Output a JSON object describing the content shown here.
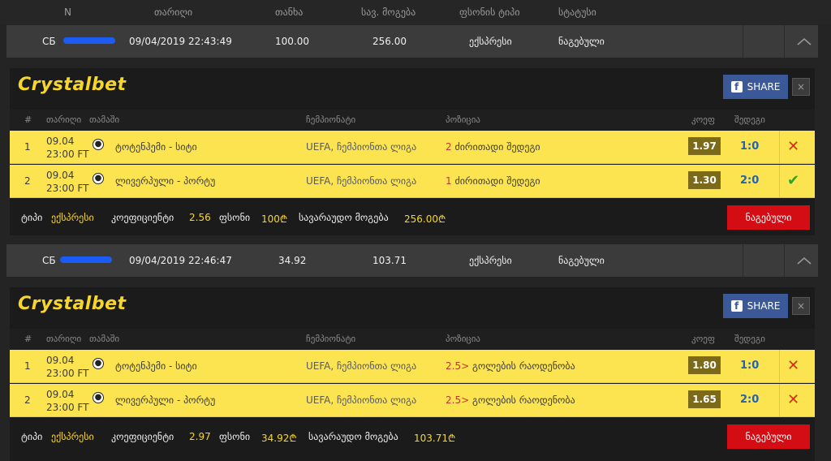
{
  "header": {
    "n": "N",
    "date": "თარიღი",
    "amount": "თანხა",
    "potential": "სავ. მოგება",
    "type": "ფსონის ტიპი",
    "status": "სტატუსი"
  },
  "slips": [
    {
      "id": "СБ",
      "date": "09/04/2019 22:43:49",
      "amount": "100.00",
      "potential": "256.00",
      "type": "ექსპრესი",
      "status": "ნაგებული",
      "card": {
        "logo": "Crystalbet",
        "share_label": "SHARE",
        "close_label": "×",
        "columns": {
          "num": "#",
          "date": "თარიღი",
          "match": "თამაში",
          "champ": "ჩემპიონატი",
          "pos": "პოზიცია",
          "odd": "კოეფ",
          "result": "შედეგი"
        },
        "bets": [
          {
            "num": "1",
            "date": "09.04",
            "time": "23:00 FT",
            "match": "ტოტენჰემი - სიტი",
            "champ": "UEFA, ჩემპიონთა ლიგა",
            "pos_hl": "2",
            "pos_rest": " ძირითადი შედეგი",
            "odd": "1.97",
            "result": "1:0",
            "mark": "✕",
            "mark_type": "loss"
          },
          {
            "num": "2",
            "date": "09.04",
            "time": "23:00 FT",
            "match": "ლივერპული - პორტუ",
            "champ": "UEFA, ჩემპიონთა ლიგა",
            "pos_hl": "1",
            "pos_rest": " ძირითადი შედეგი",
            "odd": "1.30",
            "result": "2:0",
            "mark": "✔",
            "mark_type": "win"
          }
        ],
        "summary": {
          "type_label": "ტიპი",
          "type_value": "ექსპრესი",
          "coef_label": "კოეფიციენტი",
          "coef_value": "2.56",
          "stake_label": "ფსონი",
          "stake_value": "100₾",
          "pot_label": "სავარაუდო მოგება",
          "pot_value": "256.00₾",
          "status": "ნაგებული"
        }
      }
    },
    {
      "id": "СБ",
      "date": "09/04/2019 22:46:47",
      "amount": "34.92",
      "potential": "103.71",
      "type": "ექსპრესი",
      "status": "ნაგებული",
      "card": {
        "logo": "Crystalbet",
        "share_label": "SHARE",
        "close_label": "×",
        "columns": {
          "num": "#",
          "date": "თარიღი",
          "match": "თამაში",
          "champ": "ჩემპიონატი",
          "pos": "პოზიცია",
          "odd": "კოეფ",
          "result": "შედეგი"
        },
        "bets": [
          {
            "num": "1",
            "date": "09.04",
            "time": "23:00 FT",
            "match": "ტოტენჰემი - სიტი",
            "champ": "UEFA, ჩემპიონთა ლიგა",
            "pos_hl": "2.5>",
            "pos_rest": " გოლების რაოდენობა",
            "odd": "1.80",
            "result": "1:0",
            "mark": "✕",
            "mark_type": "loss"
          },
          {
            "num": "2",
            "date": "09.04",
            "time": "23:00 FT",
            "match": "ლივერპული - პორტუ",
            "champ": "UEFA, ჩემპიონთა ლიგა",
            "pos_hl": "2.5>",
            "pos_rest": " გოლების რაოდენობა",
            "odd": "1.65",
            "result": "2:0",
            "mark": "✕",
            "mark_type": "loss"
          }
        ],
        "summary": {
          "type_label": "ტიპი",
          "type_value": "ექსპრესი",
          "coef_label": "კოეფიციენტი",
          "coef_value": "2.97",
          "stake_label": "ფსონი",
          "stake_value": "34.92₾",
          "pot_label": "სავარაუდო მოგება",
          "pot_value": "103.71₾",
          "status": "ნაგებული"
        }
      }
    }
  ]
}
